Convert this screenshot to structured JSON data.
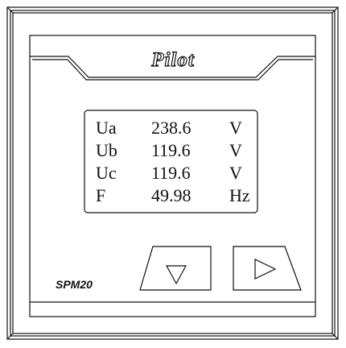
{
  "device": {
    "brand": "Pilot",
    "model": "SPM20"
  },
  "display": {
    "rows": [
      {
        "label": "Ua",
        "value": "238.6",
        "unit": "V"
      },
      {
        "label": "Ub",
        "value": "119.6",
        "unit": "V"
      },
      {
        "label": "Uc",
        "value": "119.6",
        "unit": "V"
      },
      {
        "label": "F",
        "value": "49.98",
        "unit": "Hz"
      }
    ]
  },
  "buttons": {
    "down": {
      "icon": "triangle-down-icon"
    },
    "right": {
      "icon": "triangle-right-icon"
    }
  }
}
